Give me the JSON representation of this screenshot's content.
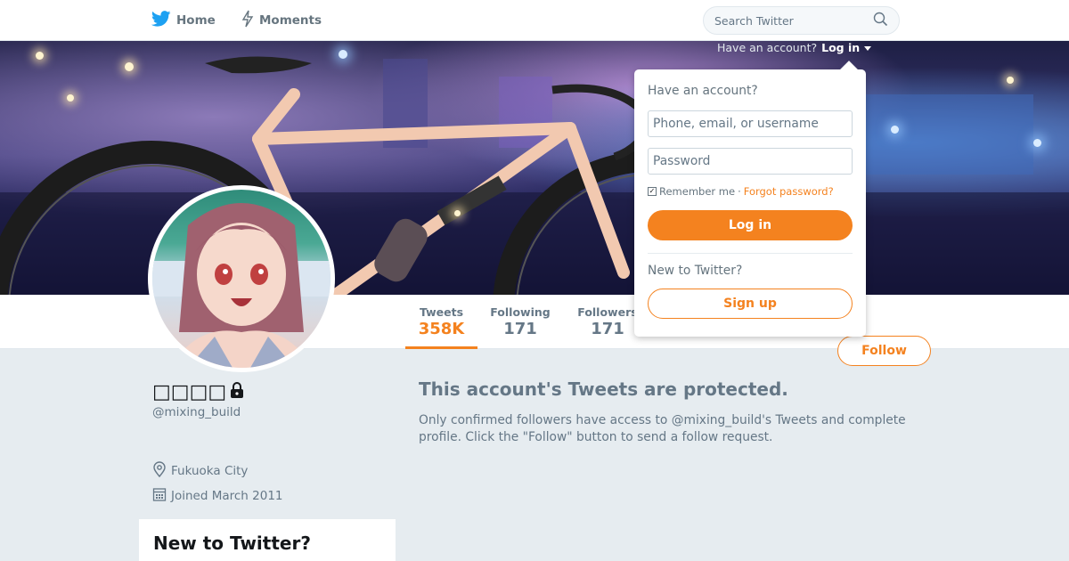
{
  "nav": {
    "home_label": "Home",
    "moments_label": "Moments",
    "search_placeholder": "Search Twitter"
  },
  "account_bar": {
    "prompt": "Have an account?",
    "login_label": "Log in"
  },
  "login_dropdown": {
    "heading": "Have an account?",
    "username_placeholder": "Phone, email, or username",
    "password_placeholder": "Password",
    "remember_label": "Remember me",
    "separator": "·",
    "forgot_label": "Forgot password?",
    "login_button": "Log in",
    "new_heading": "New to Twitter?",
    "signup_button": "Sign up"
  },
  "profile": {
    "display_name": "□□□□",
    "handle": "@mixing_build",
    "location": "Fukuoka City",
    "joined": "Joined March 2011"
  },
  "stats": [
    {
      "label": "Tweets",
      "value": "358K",
      "active": true
    },
    {
      "label": "Following",
      "value": "171",
      "active": false
    },
    {
      "label": "Followers",
      "value": "171",
      "active": false
    }
  ],
  "follow_button": "Follow",
  "protected": {
    "title": "This account's Tweets are protected.",
    "text": "Only confirmed followers have access to @mixing_build's Tweets and complete profile. Click the \"Follow\" button to send a follow request."
  },
  "sidebar_card": {
    "heading": "New to Twitter?"
  },
  "colors": {
    "accent": "#f4821f",
    "brand": "#1da1f2",
    "muted": "#657786",
    "background": "#e6ecf0"
  },
  "icons": [
    "twitter-bird-icon",
    "lightning-icon",
    "search-icon",
    "caret-down-icon",
    "lock-icon",
    "location-pin-icon",
    "calendar-icon",
    "checkbox-icon"
  ]
}
